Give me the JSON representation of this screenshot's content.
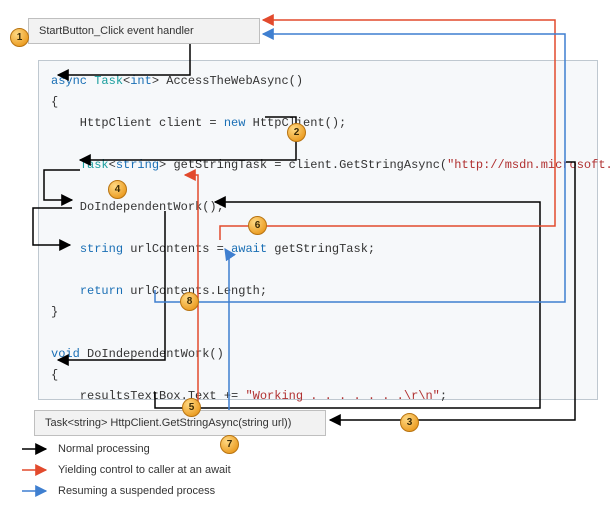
{
  "boxes": {
    "top": "StartButton_Click event handler",
    "bottom": "Task<string> HttpClient.GetStringAsync(string url))"
  },
  "code": {
    "sig_async": "async",
    "sig_task": "Task",
    "sig_int": "int",
    "sig_name": "> AccessTheWebAsync()",
    "brace_open": "{",
    "line_client_pre": "    HttpClient client = ",
    "line_client_new": "new",
    "line_client_post": " HttpClient();",
    "line_task_kw": "Task",
    "line_task_string": "string",
    "line_task_mid": "> getStringTask = client.GetStringAsync(",
    "line_task_url": "\"http://msdn.microsoft.com\"",
    "line_task_end": ");",
    "line_doind": "    DoIndependentWork();",
    "line_await_pre": "    ",
    "line_await_string": "string",
    "line_await_mid": " urlContents = ",
    "line_await_kw": "await",
    "line_await_post": " getStringTask;",
    "line_return_pre": "    ",
    "line_return_kw": "return",
    "line_return_post": " urlContents.Length;",
    "brace_close": "}",
    "sig2_void": "void",
    "sig2_name": " DoIndependentWork()",
    "brace2_open": "{",
    "line_results_pre": "    resultsTextBox.Text += ",
    "line_results_str": "\"Working . . . . . . .\\r\\n\"",
    "line_results_end": ";",
    "brace2_close": "}"
  },
  "badges": {
    "b1": "1",
    "b2": "2",
    "b3": "3",
    "b4": "4",
    "b5": "5",
    "b6": "6",
    "b7": "7",
    "b8": "8"
  },
  "legend": {
    "normal": "Normal processing",
    "yield": "Yielding control to caller at an await",
    "resume": "Resuming a suspended process"
  },
  "colors": {
    "black": "#000000",
    "red": "#e24a2d",
    "blue": "#3f7fd0"
  }
}
